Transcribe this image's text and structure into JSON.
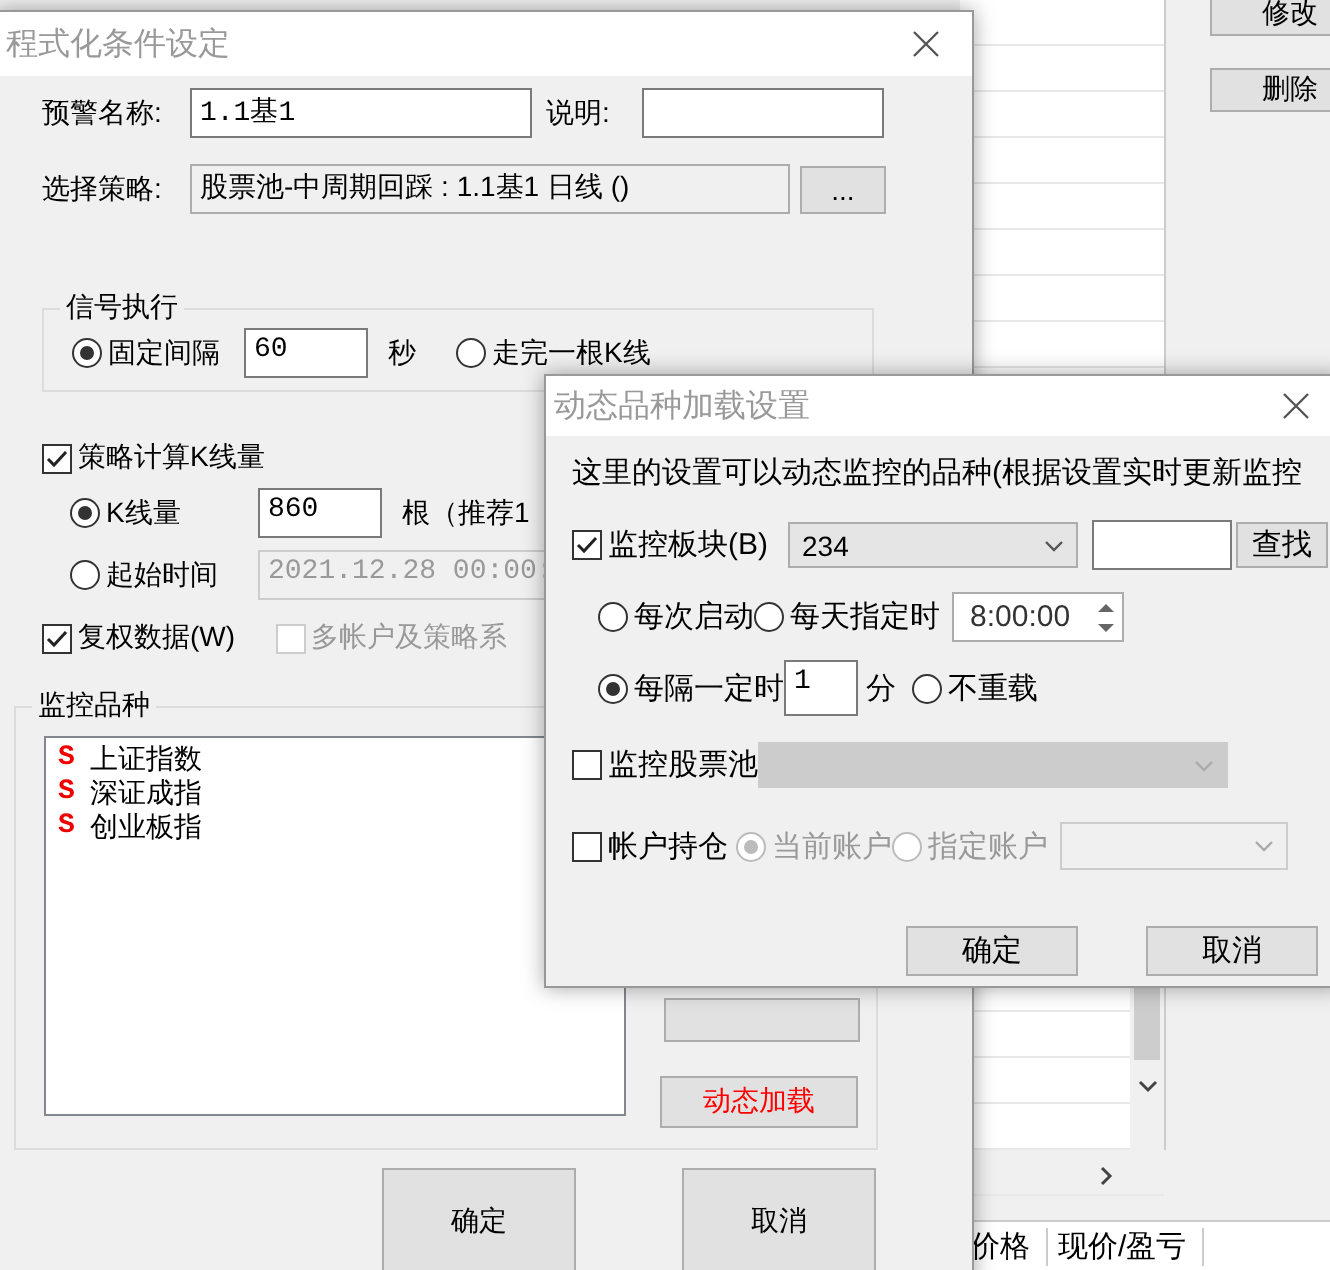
{
  "background": {
    "buttons": [
      "修改",
      "删除"
    ],
    "columns": [
      "价格",
      "现价/盈亏"
    ]
  },
  "main_dialog": {
    "title": "程式化条件设定",
    "alert_name": {
      "label": "预警名称:",
      "value": "1.1基1"
    },
    "description": {
      "label": "说明:"
    },
    "strategy": {
      "label": "选择策略:",
      "value": "股票池-中周期回踩 : 1.1基1 日线 ()",
      "button": "..."
    },
    "signal_group": {
      "title": "信号执行",
      "interval": "60",
      "unit": "秒",
      "options": [
        {
          "label": "固定间隔",
          "selected": true
        },
        {
          "label": "走完一根K线",
          "selected": false
        }
      ]
    },
    "kline_count": {
      "label": "策略计算K线量",
      "checked": true,
      "count": "860",
      "count_note": "根（推荐1",
      "start_time": "2021.12.28 00:00:",
      "start_time_disabled": true,
      "options": [
        {
          "label": "K线量",
          "selected": true
        },
        {
          "label": "起始时间",
          "selected": false
        }
      ]
    },
    "adjusted_data": {
      "label": "复权数据(W)",
      "checked": true,
      "disabled": false
    },
    "multi_account": {
      "label": "多帐户及策略系",
      "checked": false,
      "disabled": true
    },
    "watch_group": {
      "title": "监控品种",
      "dynamic_button": "动态加载",
      "items": [
        {
          "marker": "S",
          "name": "上证指数"
        },
        {
          "marker": "S",
          "name": "深证成指"
        },
        {
          "marker": "S",
          "name": "创业板指"
        }
      ]
    },
    "buttons": [
      "确定",
      "取消"
    ]
  },
  "dynamic_dialog": {
    "title": "动态品种加载设置",
    "intro": "这里的设置可以动态监控的品种(根据设置实时更新监控",
    "sector": {
      "label": "监控板块(B)",
      "checked": true,
      "value": "234",
      "find_button": "查找"
    },
    "reload_options": [
      {
        "label": "每次启动",
        "selected": false
      },
      {
        "label": "每天指定时",
        "selected": false
      },
      {
        "label": "每隔一定时",
        "selected": true
      },
      {
        "label": "不重载",
        "selected": false
      }
    ],
    "daily_time": "8:00:00",
    "interval": "1",
    "interval_unit": "分",
    "stock_pool": {
      "label": "监控股票池",
      "checked": false,
      "dropdown_disabled": true
    },
    "holdings": {
      "label": "帐户持仓",
      "checked": false,
      "options": [
        {
          "label": "当前账户",
          "selected": true,
          "disabled": true
        },
        {
          "label": "指定账户",
          "selected": false,
          "disabled": true
        }
      ],
      "account_disabled": true
    },
    "buttons": [
      "确定",
      "取消"
    ]
  }
}
